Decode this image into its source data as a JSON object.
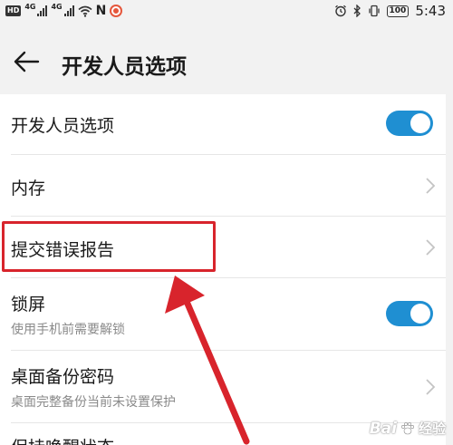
{
  "status_bar": {
    "hd": "HD",
    "net1": "4G",
    "net2": "4G",
    "nfc": "N",
    "battery": "100",
    "time": "5:43"
  },
  "header": {
    "title": "开发人员选项"
  },
  "settings": {
    "developer_options": {
      "title": "开发人员选项",
      "enabled": true
    },
    "memory": {
      "title": "内存"
    },
    "bug_report": {
      "title": "提交错误报告"
    },
    "lock_screen": {
      "title": "锁屏",
      "subtitle": "使用手机前需要解锁",
      "enabled": true
    },
    "desktop_backup_password": {
      "title": "桌面备份密码",
      "subtitle": "桌面完整备份当前未设置保护"
    },
    "stay_awake": {
      "title": "保持唤醒状态"
    }
  },
  "watermark": {
    "brand": "Bai",
    "brand2": "经验"
  },
  "colors": {
    "toggle_on": "#1f8fd2",
    "highlight": "#d8242c",
    "arrow": "#d8242c"
  }
}
